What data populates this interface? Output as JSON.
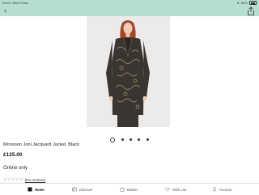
{
  "status": {
    "time": "09:44",
    "date": "Wed 9 Nov",
    "battery": "84%"
  },
  "nav": {
    "back_icon": "chevron-left-icon",
    "share_icon": "share-icon"
  },
  "product": {
    "name": "Monsoon Joni Jacquard Jacket, Black",
    "price": "£125.00",
    "availability": "Online only",
    "rating_stars": "☆☆",
    "rating_stars_teal": "☆☆☆",
    "reviews": "(No reviews)"
  },
  "carousel": {
    "count": 5,
    "active_index": 0
  },
  "tabs": [
    {
      "label": "Home",
      "icon": "home-icon"
    },
    {
      "label": "Discover",
      "icon": "discover-icon"
    },
    {
      "label": "Basket",
      "icon": "basket-icon"
    },
    {
      "label": "Wish List",
      "icon": "heart-icon"
    },
    {
      "label": "Account",
      "icon": "account-icon"
    }
  ],
  "colors": {
    "header": "#b5ded0",
    "accent": "#2c9a7b"
  }
}
